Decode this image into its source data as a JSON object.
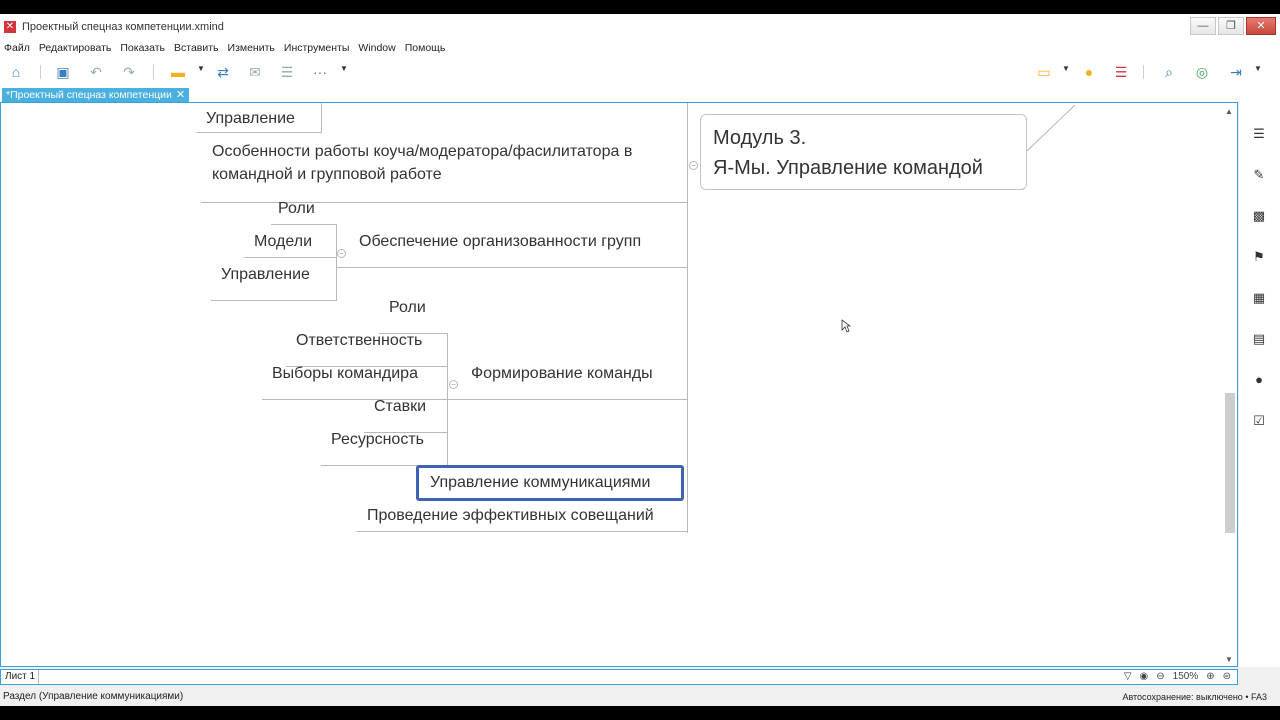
{
  "window": {
    "title": "Проектный спецназ компетенции.xmind",
    "controls": {
      "minimize": "—",
      "restore": "❐",
      "close": "✕"
    }
  },
  "menu": [
    "Файл",
    "Редактировать",
    "Показать",
    "Вставить",
    "Изменить",
    "Инструменты",
    "Window",
    "Помощь"
  ],
  "toolbar": {
    "icons": [
      "home-icon",
      "save-icon",
      "undo-icon",
      "redo-icon",
      "folder-icon",
      "sync-icon",
      "share-icon",
      "export-icon",
      "more-icon",
      "presentation-icon",
      "lightbulb-icon",
      "gantt-icon",
      "search-icon",
      "share-circle-icon",
      "exit-icon"
    ],
    "more_glyph": "···"
  },
  "doc_tab": {
    "label": "*Проектный спецназ компетенции",
    "close": "✕"
  },
  "mindmap": {
    "central_topic": {
      "line1": "Модуль 3.",
      "line2": "Я-Мы. Управление командой"
    },
    "top_partial": "Управление",
    "special_topic": {
      "line1": "Особенности работы коуча/модератора/фасилитатора в",
      "line2": "командной и групповой работе"
    },
    "group1": {
      "label": "Обеспечение организованности групп",
      "children": [
        "Роли",
        "Модели",
        "Управление"
      ]
    },
    "group2": {
      "label": "Формирование команды",
      "children": [
        "Роли",
        "Ответственность",
        "Выборы командира",
        "Ставки",
        "Ресурсность"
      ]
    },
    "selected_topic": "Управление коммуникациями",
    "last_topic": "Проведение эффективных совещаний",
    "collapse_glyph": "−"
  },
  "sidebar_icons": [
    "outline-icon",
    "format-brush-icon",
    "image-icon",
    "flag-icon",
    "style-icon",
    "notes-icon",
    "comment-icon",
    "task-icon"
  ],
  "sheet": {
    "tab": "Лист 1",
    "zoom": "150%",
    "minus": "⊖",
    "plus": "⊕"
  },
  "status": {
    "left": "Раздел (Управление коммуникациями)",
    "autosave": "Автосохранение: выключено",
    "code": "FA3"
  }
}
